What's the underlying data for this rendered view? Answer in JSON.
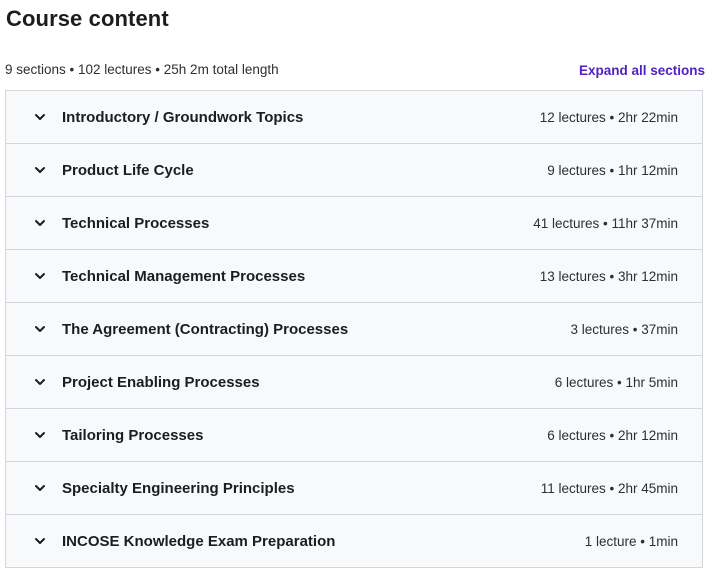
{
  "header": {
    "title": "Course content",
    "summary": "9 sections • 102 lectures • 25h 2m total length",
    "expand_all_label": "Expand all sections"
  },
  "colors": {
    "accent": "#5022c3",
    "section_background": "#f7f9fa",
    "border": "#d1d7dc",
    "text": "#1c1d1f"
  },
  "sections": [
    {
      "title": "Introductory / Groundwork Topics",
      "meta": "12 lectures • 2hr 22min",
      "icon": "chevron-down-icon"
    },
    {
      "title": "Product Life Cycle",
      "meta": "9 lectures • 1hr 12min",
      "icon": "chevron-down-icon"
    },
    {
      "title": "Technical Processes",
      "meta": "41 lectures • 11hr 37min",
      "icon": "chevron-down-icon"
    },
    {
      "title": "Technical Management Processes",
      "meta": "13 lectures • 3hr 12min",
      "icon": "chevron-down-icon"
    },
    {
      "title": "The Agreement (Contracting) Processes",
      "meta": "3 lectures • 37min",
      "icon": "chevron-down-icon"
    },
    {
      "title": "Project Enabling Processes",
      "meta": "6 lectures • 1hr 5min",
      "icon": "chevron-down-icon"
    },
    {
      "title": "Tailoring Processes",
      "meta": "6 lectures • 2hr 12min",
      "icon": "chevron-down-icon"
    },
    {
      "title": "Specialty Engineering Principles",
      "meta": "11 lectures • 2hr 45min",
      "icon": "chevron-down-icon"
    },
    {
      "title": "INCOSE Knowledge Exam Preparation",
      "meta": "1 lecture • 1min",
      "icon": "chevron-down-icon"
    }
  ]
}
